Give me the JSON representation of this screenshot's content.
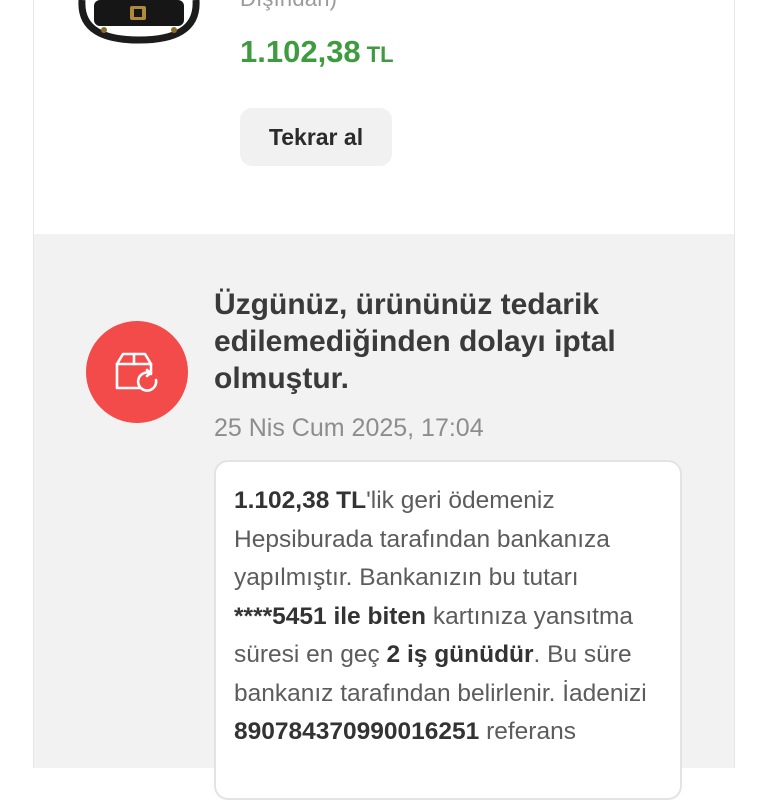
{
  "product": {
    "title_tail": "Dışından)",
    "price_amount": "1.102,38",
    "price_currency": "TL",
    "buy_again_label": "Tekrar al",
    "thumbnail_icon": "handbag-image"
  },
  "status": {
    "icon": "box-return-icon",
    "icon_bg_color": "#f34a4a",
    "title": "Üzgünüz, ürününüz tedarik edilemediğinden dolayı iptal olmuştur.",
    "date": "25 Nis Cum 2025, 17:04"
  },
  "refund_info": {
    "amount": "1.102,38 TL",
    "text_1": "'lik geri ödemeniz Hepsiburada tarafından bankanıza yapılmıştır. Bankanızın bu tutarı ",
    "card": "****5451 ile biten",
    "text_2": " kartınıza yansıtma süresi en geç ",
    "duration": "2 iş günüdür",
    "text_3": ". Bu süre bankanız tarafından belirlenir. İadenizi ",
    "reference": "890784370990016251",
    "text_4": " referans"
  },
  "colors": {
    "price_green": "#3f9b3f",
    "section_bg": "#f2f2f2"
  }
}
